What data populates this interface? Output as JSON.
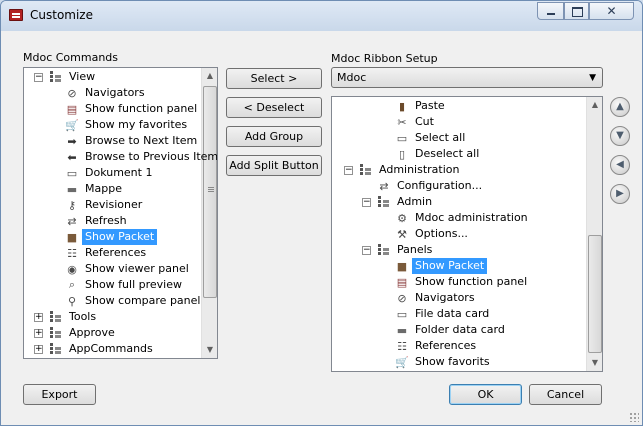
{
  "window": {
    "title": "Customize"
  },
  "left_panel": {
    "label": "Mdoc Commands",
    "items": [
      {
        "label": "View",
        "icon": "tree-node-icon",
        "expander": "-",
        "level": 0
      },
      {
        "label": "Navigators",
        "icon": "compass-icon",
        "level": 1
      },
      {
        "label": "Show function panel",
        "icon": "function-panel-icon",
        "level": 1
      },
      {
        "label": "Show my favorites",
        "icon": "favorites-cart-icon",
        "level": 1
      },
      {
        "label": "Browse to Next Item",
        "icon": "arrow-right-icon",
        "level": 1
      },
      {
        "label": "Browse to Previous Item",
        "icon": "arrow-left-icon",
        "level": 1
      },
      {
        "label": "Dokument 1",
        "icon": "document-icon",
        "level": 1
      },
      {
        "label": "Mappe",
        "icon": "folder-icon",
        "level": 1
      },
      {
        "label": "Revisioner",
        "icon": "revisions-icon",
        "level": 1
      },
      {
        "label": "Refresh",
        "icon": "refresh-icon",
        "level": 1
      },
      {
        "label": "Show Packet",
        "icon": "packet-icon",
        "level": 1,
        "selected": true
      },
      {
        "label": "References",
        "icon": "references-icon",
        "level": 1
      },
      {
        "label": "Show viewer panel",
        "icon": "eye-icon",
        "level": 1
      },
      {
        "label": "Show full preview",
        "icon": "full-preview-icon",
        "level": 1
      },
      {
        "label": "Show compare panel",
        "icon": "compare-icon",
        "level": 1
      },
      {
        "label": "Tools",
        "icon": "tree-node-icon",
        "expander": "+",
        "level": 0
      },
      {
        "label": "Approve",
        "icon": "tree-node-icon",
        "expander": "+",
        "level": 0
      },
      {
        "label": "AppCommands",
        "icon": "tree-node-icon",
        "expander": "+",
        "level": 0
      }
    ]
  },
  "middle_buttons": {
    "select": "Select >",
    "deselect": "< Deselect",
    "add_group": "Add Group",
    "add_split": "Add Split Button"
  },
  "right_panel": {
    "label": "Mdoc Ribbon Setup",
    "combo_value": "Mdoc",
    "items": [
      {
        "label": "Paste",
        "icon": "paste-icon",
        "level": 2
      },
      {
        "label": "Cut",
        "icon": "scissors-icon",
        "level": 2
      },
      {
        "label": "Select all",
        "icon": "document-icon",
        "level": 2
      },
      {
        "label": "Deselect all",
        "icon": "deselect-icon",
        "level": 2
      },
      {
        "label": "Administration",
        "icon": "tab-icon",
        "expander": "-",
        "level": 0
      },
      {
        "label": "Configuration...",
        "icon": "configuration-icon",
        "level": 1
      },
      {
        "label": "Admin",
        "icon": "group-icon",
        "expander": "-",
        "level": 1
      },
      {
        "label": "Mdoc administration",
        "icon": "gear-icon",
        "level": 2
      },
      {
        "label": "Options...",
        "icon": "options-icon",
        "level": 2
      },
      {
        "label": "Panels",
        "icon": "group-icon",
        "expander": "-",
        "level": 1
      },
      {
        "label": "Show Packet",
        "icon": "packet-icon",
        "level": 2,
        "selected": true
      },
      {
        "label": "Show function panel",
        "icon": "function-panel-icon",
        "level": 2
      },
      {
        "label": "Navigators",
        "icon": "compass-icon",
        "level": 2
      },
      {
        "label": "File data card",
        "icon": "file-card-icon",
        "level": 2
      },
      {
        "label": "Folder data card",
        "icon": "folder-icon",
        "level": 2
      },
      {
        "label": "References",
        "icon": "references-icon",
        "level": 2
      },
      {
        "label": "Show favorits",
        "icon": "favorites-cart-icon",
        "level": 2
      }
    ]
  },
  "side_buttons": [
    {
      "name": "move-up-button",
      "icon": "arrow-up-icon"
    },
    {
      "name": "move-down-button",
      "icon": "arrow-down-icon"
    },
    {
      "name": "move-left-button",
      "icon": "arrow-left-icon"
    },
    {
      "name": "move-right-button",
      "icon": "arrow-right-icon"
    }
  ],
  "footer": {
    "export": "Export",
    "ok": "OK",
    "cancel": "Cancel"
  },
  "colors": {
    "selection": "#3399ff",
    "window_bg": "#f0f0f0",
    "titlebar": "#c9d8ea"
  }
}
